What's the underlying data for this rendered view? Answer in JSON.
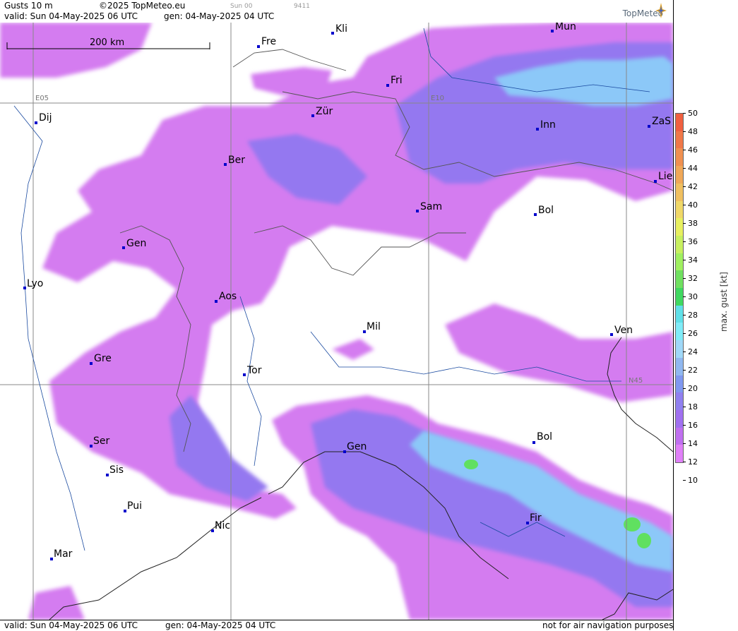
{
  "header": {
    "title": "Gusts 10 m",
    "copyright": "©2025 TopMeteo.eu",
    "valid": "valid:  Sun  04-May-2025  06 UTC",
    "gen": "gen:  04-May-2025  04 UTC",
    "small_time": "Sun 00",
    "small_code": "9411",
    "brand": "TopMeteo"
  },
  "footer": {
    "valid": "valid:  Sun  04-May-2025  06 UTC",
    "gen": "gen:  04-May-2025  04 UTC",
    "disclaimer": "not for air navigation purposes"
  },
  "scale_bar": "200 km",
  "gridlines": [
    "E05",
    "E10",
    "N45"
  ],
  "cities": [
    "Kli",
    "Mun",
    "Fre",
    "Fri",
    "Dij",
    "Zür",
    "Inn",
    "ZaS",
    "Ber",
    "Lie",
    "Sam",
    "Bol",
    "Gen",
    "Lyo",
    "Aos",
    "Ven",
    "Mil",
    "Gre",
    "Tor",
    "Ser",
    "Gen",
    "Bol",
    "Sis",
    "Pui",
    "Fir",
    "Nic",
    "Mar"
  ],
  "colorbar": {
    "title": "max. gust [kt]",
    "ticks": [
      "50",
      "48",
      "46",
      "44",
      "42",
      "40",
      "38",
      "36",
      "34",
      "32",
      "30",
      "28",
      "26",
      "24",
      "22",
      "20",
      "18",
      "16",
      "14",
      "12",
      "10"
    ],
    "colors": [
      "#f06040",
      "#f07848",
      "#f09050",
      "#f0a858",
      "#f0c060",
      "#f0d868",
      "#e8f060",
      "#c8f060",
      "#a0f060",
      "#70e060",
      "#40d860",
      "#60e0e8",
      "#80ecf8",
      "#a0d8f8",
      "#90b8f0",
      "#8098f0",
      "#9080f0",
      "#a070f0",
      "#c070f0",
      "#e080f8"
    ]
  }
}
